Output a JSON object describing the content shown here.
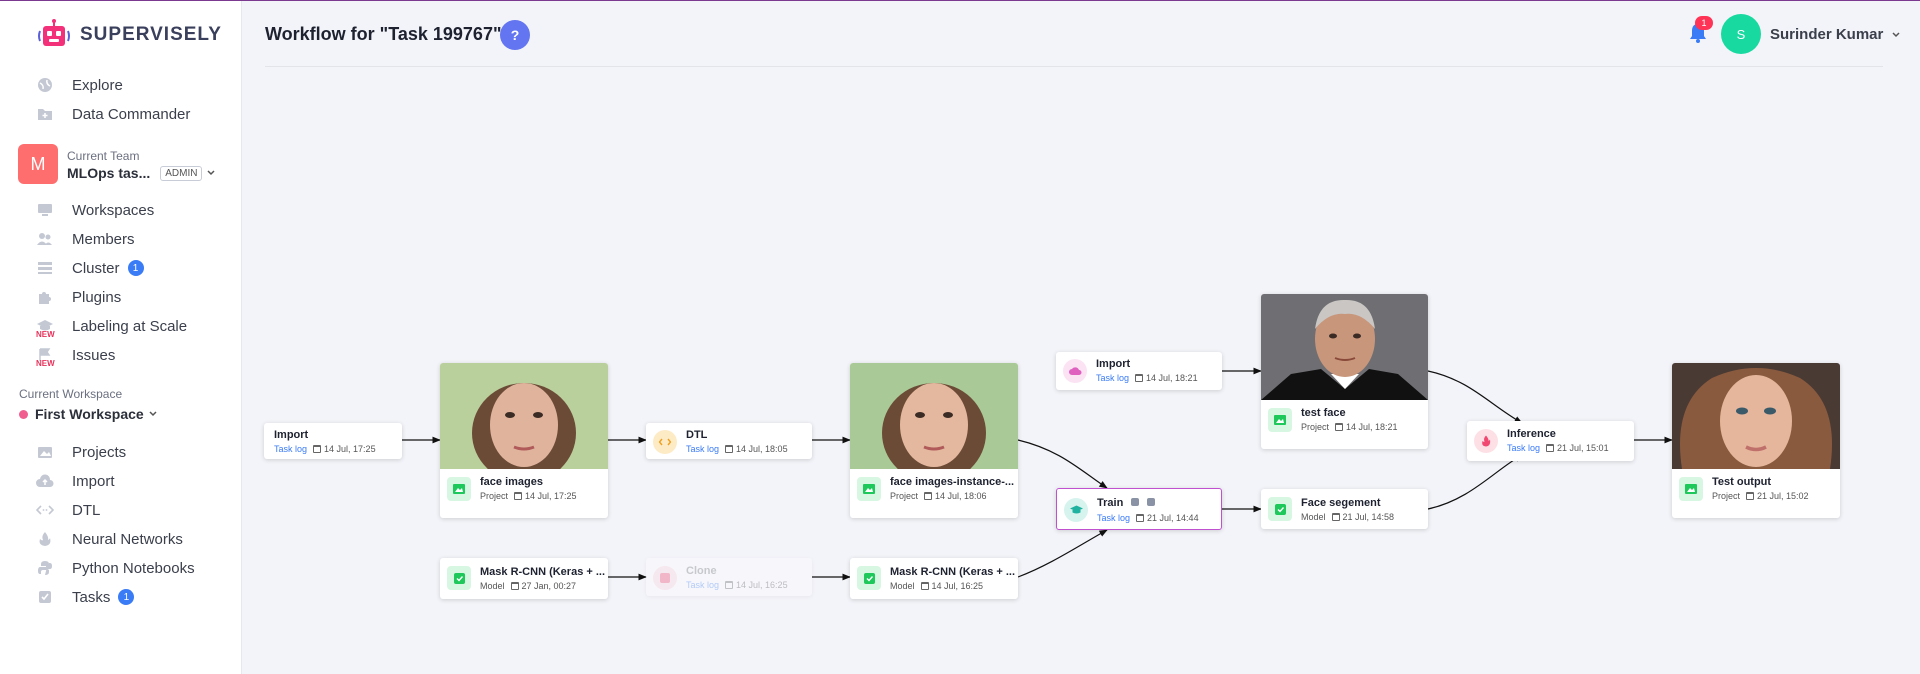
{
  "app": {
    "logo_text": "SUPERVISELY"
  },
  "sidebar": {
    "top_items": [
      {
        "label": "Explore",
        "icon": "globe-icon"
      },
      {
        "label": "Data Commander",
        "icon": "folder-plus-icon"
      }
    ],
    "team": {
      "label": "Current Team",
      "avatar": "M",
      "name": "MLOps tas...",
      "role": "ADMIN"
    },
    "team_items": [
      {
        "label": "Workspaces",
        "icon": "monitor-icon"
      },
      {
        "label": "Members",
        "icon": "users-icon"
      },
      {
        "label": "Cluster",
        "icon": "server-icon",
        "badge": "1"
      },
      {
        "label": "Plugins",
        "icon": "puzzle-icon"
      },
      {
        "label": "Labeling at Scale",
        "icon": "graduation-icon",
        "tag": "NEW"
      },
      {
        "label": "Issues",
        "icon": "flag-icon",
        "tag": "NEW"
      }
    ],
    "workspace": {
      "label": "Current Workspace",
      "name": "First Workspace"
    },
    "ws_items": [
      {
        "label": "Projects",
        "icon": "images-icon"
      },
      {
        "label": "Import",
        "icon": "cloud-upload-icon"
      },
      {
        "label": "DTL",
        "icon": "code-icon"
      },
      {
        "label": "Neural Networks",
        "icon": "flame-icon"
      },
      {
        "label": "Python Notebooks",
        "icon": "python-icon"
      },
      {
        "label": "Tasks",
        "icon": "checkbox-icon",
        "badge": "1"
      }
    ]
  },
  "header": {
    "title": "Workflow for \"Task 199767\"",
    "help": "?",
    "notifications": "1",
    "user_initial": "S",
    "user_name": "Surinder Kumar"
  },
  "graph": {
    "nodes": {
      "import1": {
        "title": "Import",
        "link": "Task log",
        "date": "14 Jul, 17:25"
      },
      "face_images": {
        "title": "face images",
        "type": "Project",
        "date": "14 Jul, 17:25"
      },
      "dtl": {
        "title": "DTL",
        "link": "Task log",
        "date": "14 Jul, 18:05"
      },
      "face_instance": {
        "title": "face images-instance-...",
        "type": "Project",
        "date": "14 Jul, 18:06"
      },
      "import2": {
        "title": "Import",
        "link": "Task log",
        "date": "14 Jul, 18:21"
      },
      "test_face": {
        "title": "test face",
        "type": "Project",
        "date": "14 Jul, 18:21"
      },
      "train": {
        "title": "Train",
        "link": "Task log",
        "date": "21 Jul, 14:44"
      },
      "face_seg": {
        "title": "Face segement",
        "type": "Model",
        "date": "21 Jul, 14:58"
      },
      "inference": {
        "title": "Inference",
        "link": "Task log",
        "date": "21 Jul, 15:01"
      },
      "test_output": {
        "title": "Test output",
        "type": "Project",
        "date": "21 Jul, 15:02"
      },
      "mask1": {
        "title": "Mask R-CNN (Keras + ...",
        "type": "Model",
        "date": "27 Jan, 00:27"
      },
      "clone": {
        "title": "Clone",
        "link": "Task log",
        "date": "14 Jul, 16:25"
      },
      "mask2": {
        "title": "Mask R-CNN (Keras + ...",
        "type": "Model",
        "date": "14 Jul, 16:25"
      }
    }
  },
  "colors": {
    "accent": "#3a7bf6",
    "green": "#1ec85a",
    "selected_border": "#c050d0",
    "badge_red": "#ff3355"
  }
}
